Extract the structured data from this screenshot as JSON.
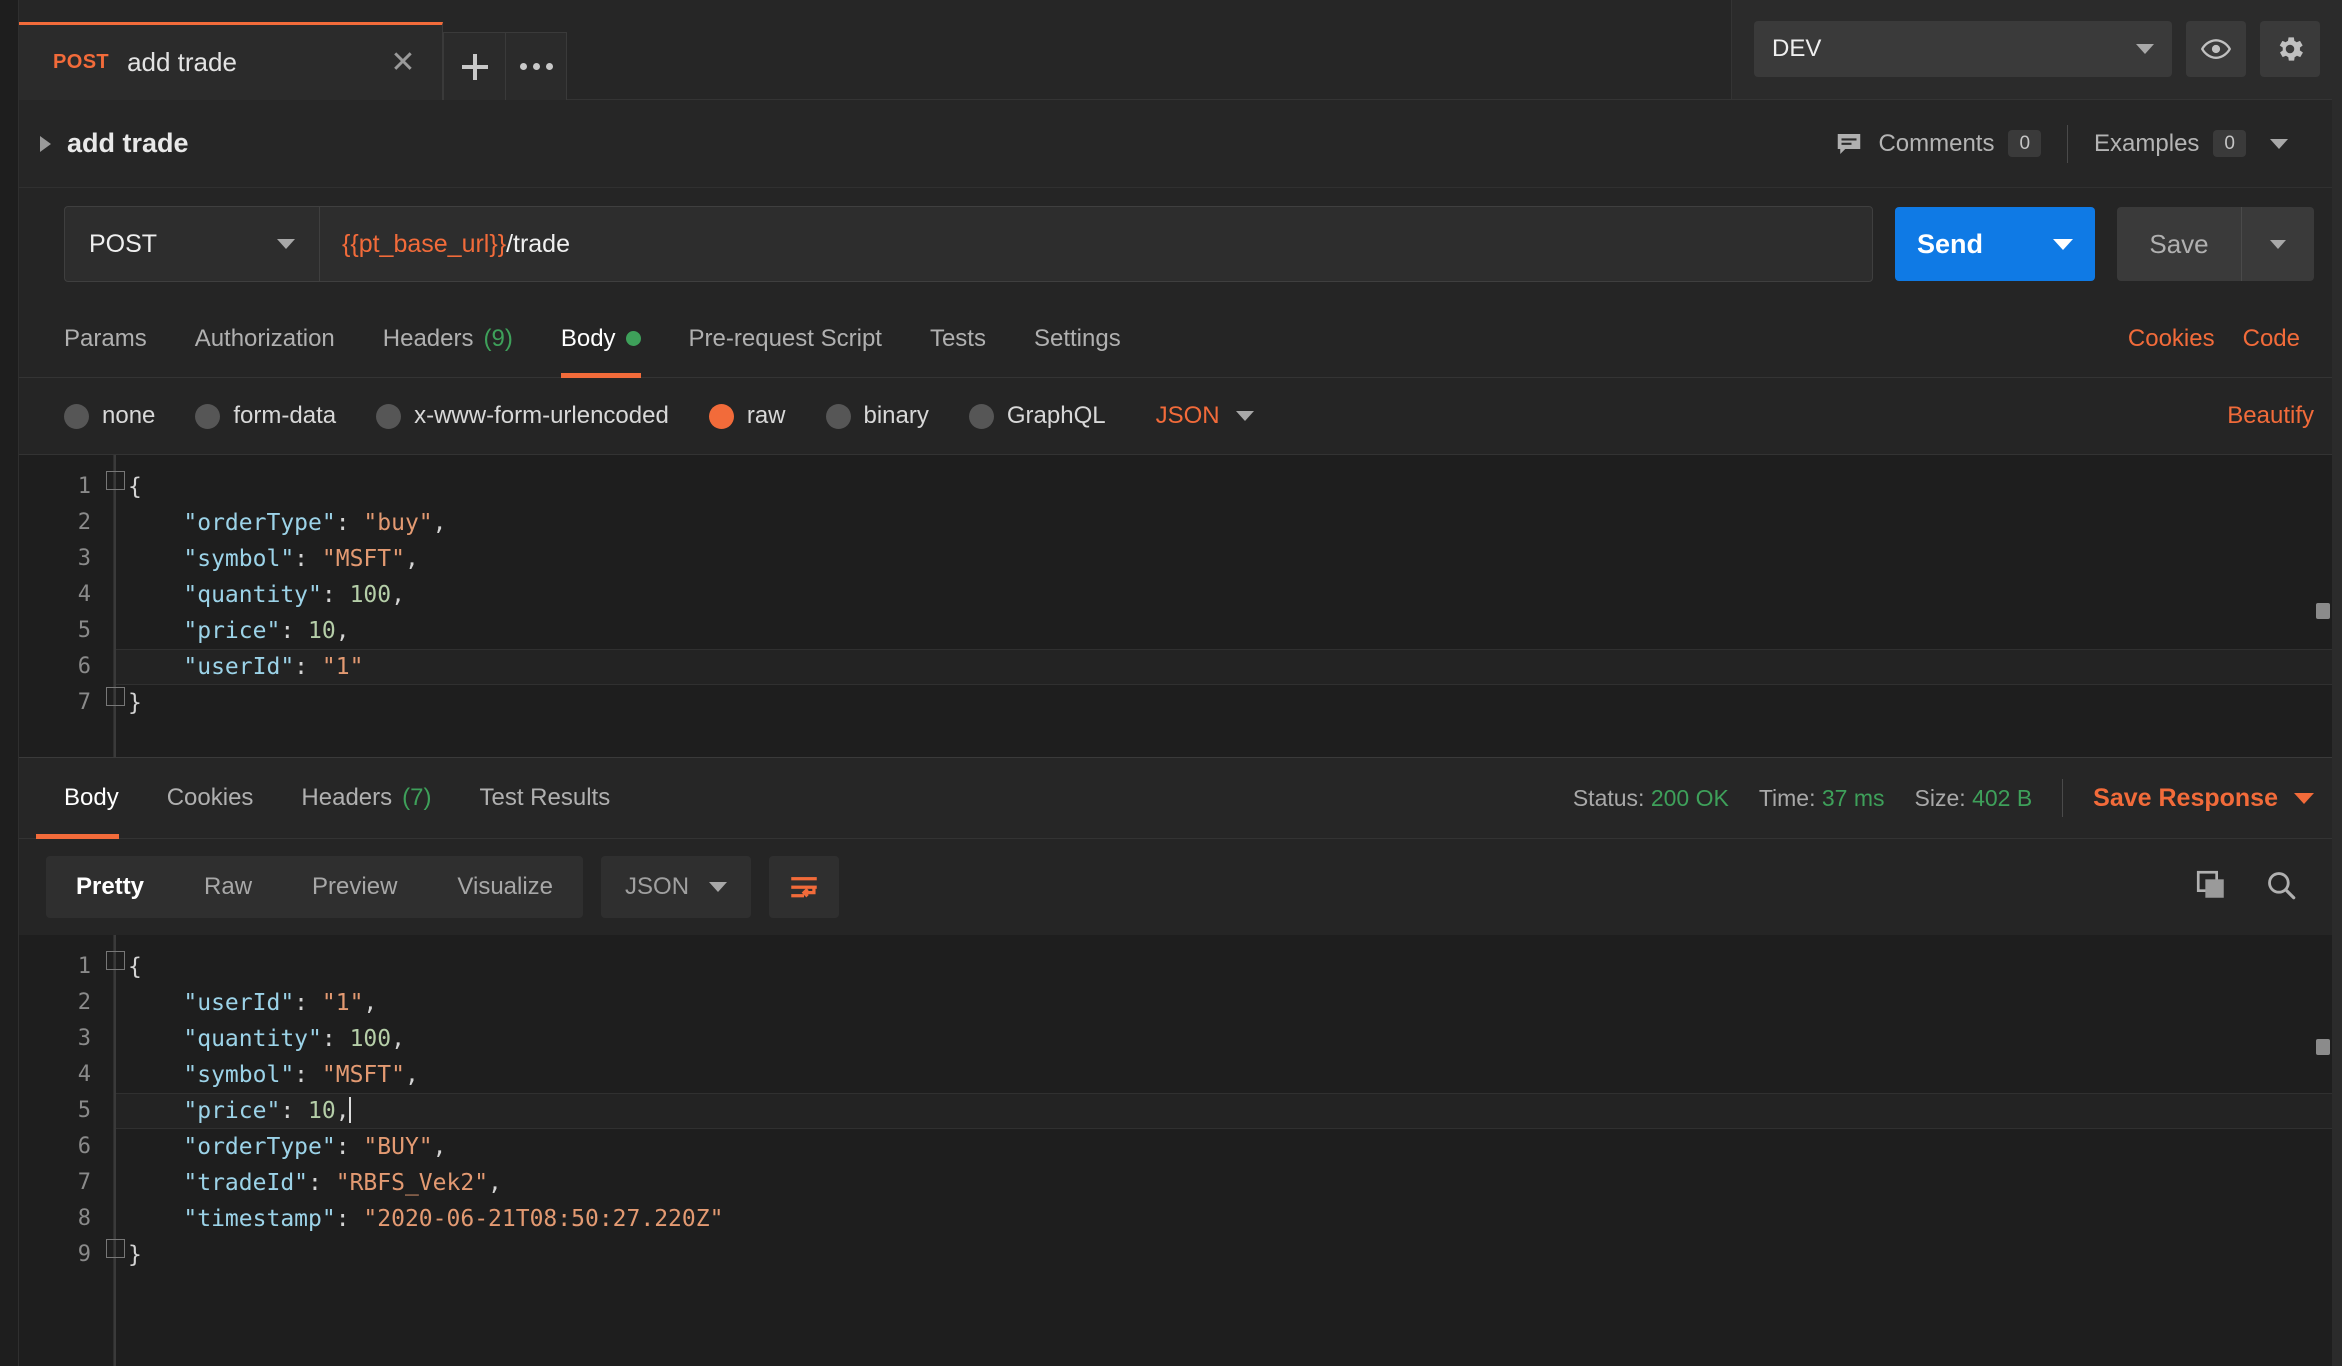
{
  "window": {
    "tab": {
      "method": "POST",
      "title": "add trade",
      "close_icon": "close-icon",
      "new_tab_icon": "plus-icon",
      "more_icon": "ellipsis-icon"
    },
    "environment": {
      "selected": "DEV",
      "eye_icon": "eye-icon",
      "gear_icon": "gear-icon"
    }
  },
  "breadcrumb": {
    "expander_icon": "chevron-right-icon",
    "title": "add trade",
    "comments_icon": "comment-icon",
    "comments_label": "Comments",
    "comments_count": "0",
    "examples_label": "Examples",
    "examples_count": "0"
  },
  "request": {
    "method": "POST",
    "url_variable": "{{pt_base_url}}",
    "url_path": "/trade",
    "send_label": "Send",
    "save_label": "Save",
    "tabs": [
      {
        "label": "Params",
        "count": "",
        "active": false
      },
      {
        "label": "Authorization",
        "count": "",
        "active": false
      },
      {
        "label": "Headers",
        "count": "(9)",
        "active": false
      },
      {
        "label": "Body",
        "count": "",
        "active": true
      },
      {
        "label": "Pre-request Script",
        "count": "",
        "active": false
      },
      {
        "label": "Tests",
        "count": "",
        "active": false
      },
      {
        "label": "Settings",
        "count": "",
        "active": false
      }
    ],
    "cookies_link": "Cookies",
    "code_link": "Code",
    "body_types": [
      {
        "label": "none",
        "selected": false
      },
      {
        "label": "form-data",
        "selected": false
      },
      {
        "label": "x-www-form-urlencoded",
        "selected": false
      },
      {
        "label": "raw",
        "selected": true
      },
      {
        "label": "binary",
        "selected": false
      },
      {
        "label": "GraphQL",
        "selected": false
      }
    ],
    "raw_format": "JSON",
    "beautify_label": "Beautify",
    "body_lines": [
      {
        "n": "1",
        "tokens": [
          {
            "t": "p",
            "v": "{"
          }
        ]
      },
      {
        "n": "2",
        "tokens": [
          {
            "t": "p",
            "v": "    "
          },
          {
            "t": "k",
            "v": "\"orderType\""
          },
          {
            "t": "p",
            "v": ": "
          },
          {
            "t": "s",
            "v": "\"buy\""
          },
          {
            "t": "p",
            "v": ","
          }
        ]
      },
      {
        "n": "3",
        "tokens": [
          {
            "t": "p",
            "v": "    "
          },
          {
            "t": "k",
            "v": "\"symbol\""
          },
          {
            "t": "p",
            "v": ": "
          },
          {
            "t": "s",
            "v": "\"MSFT\""
          },
          {
            "t": "p",
            "v": ","
          }
        ]
      },
      {
        "n": "4",
        "tokens": [
          {
            "t": "p",
            "v": "    "
          },
          {
            "t": "k",
            "v": "\"quantity\""
          },
          {
            "t": "p",
            "v": ": "
          },
          {
            "t": "n",
            "v": "100"
          },
          {
            "t": "p",
            "v": ","
          }
        ]
      },
      {
        "n": "5",
        "tokens": [
          {
            "t": "p",
            "v": "    "
          },
          {
            "t": "k",
            "v": "\"price\""
          },
          {
            "t": "p",
            "v": ": "
          },
          {
            "t": "n",
            "v": "10"
          },
          {
            "t": "p",
            "v": ","
          }
        ]
      },
      {
        "n": "6",
        "hl": true,
        "tokens": [
          {
            "t": "p",
            "v": "    "
          },
          {
            "t": "k",
            "v": "\"userId\""
          },
          {
            "t": "p",
            "v": ": "
          },
          {
            "t": "s",
            "v": "\"1\""
          }
        ]
      },
      {
        "n": "7",
        "tokens": [
          {
            "t": "p",
            "v": "}"
          }
        ]
      }
    ]
  },
  "response": {
    "tabs": [
      {
        "label": "Body",
        "count": "",
        "active": true
      },
      {
        "label": "Cookies",
        "count": "",
        "active": false
      },
      {
        "label": "Headers",
        "count": "(7)",
        "active": false
      },
      {
        "label": "Test Results",
        "count": "",
        "active": false
      }
    ],
    "status_label": "Status:",
    "status_value": "200 OK",
    "time_label": "Time:",
    "time_value": "37 ms",
    "size_label": "Size:",
    "size_value": "402 B",
    "save_response_label": "Save Response",
    "view_modes": [
      {
        "label": "Pretty",
        "active": true
      },
      {
        "label": "Raw",
        "active": false
      },
      {
        "label": "Preview",
        "active": false
      },
      {
        "label": "Visualize",
        "active": false
      }
    ],
    "format": "JSON",
    "wrap_icon": "word-wrap-icon",
    "copy_icon": "copy-icon",
    "search_icon": "search-icon",
    "body_lines": [
      {
        "n": "1",
        "tokens": [
          {
            "t": "p",
            "v": "{"
          }
        ]
      },
      {
        "n": "2",
        "tokens": [
          {
            "t": "p",
            "v": "    "
          },
          {
            "t": "k",
            "v": "\"userId\""
          },
          {
            "t": "p",
            "v": ": "
          },
          {
            "t": "s",
            "v": "\"1\""
          },
          {
            "t": "p",
            "v": ","
          }
        ]
      },
      {
        "n": "3",
        "tokens": [
          {
            "t": "p",
            "v": "    "
          },
          {
            "t": "k",
            "v": "\"quantity\""
          },
          {
            "t": "p",
            "v": ": "
          },
          {
            "t": "n",
            "v": "100"
          },
          {
            "t": "p",
            "v": ","
          }
        ]
      },
      {
        "n": "4",
        "tokens": [
          {
            "t": "p",
            "v": "    "
          },
          {
            "t": "k",
            "v": "\"symbol\""
          },
          {
            "t": "p",
            "v": ": "
          },
          {
            "t": "s",
            "v": "\"MSFT\""
          },
          {
            "t": "p",
            "v": ","
          }
        ]
      },
      {
        "n": "5",
        "hl": true,
        "cursor": true,
        "tokens": [
          {
            "t": "p",
            "v": "    "
          },
          {
            "t": "k",
            "v": "\"price\""
          },
          {
            "t": "p",
            "v": ": "
          },
          {
            "t": "n",
            "v": "10"
          },
          {
            "t": "p",
            "v": ","
          }
        ]
      },
      {
        "n": "6",
        "tokens": [
          {
            "t": "p",
            "v": "    "
          },
          {
            "t": "k",
            "v": "\"orderType\""
          },
          {
            "t": "p",
            "v": ": "
          },
          {
            "t": "s",
            "v": "\"BUY\""
          },
          {
            "t": "p",
            "v": ","
          }
        ]
      },
      {
        "n": "7",
        "tokens": [
          {
            "t": "p",
            "v": "    "
          },
          {
            "t": "k",
            "v": "\"tradeId\""
          },
          {
            "t": "p",
            "v": ": "
          },
          {
            "t": "s",
            "v": "\"RBFS_Vek2\""
          },
          {
            "t": "p",
            "v": ","
          }
        ]
      },
      {
        "n": "8",
        "tokens": [
          {
            "t": "p",
            "v": "    "
          },
          {
            "t": "k",
            "v": "\"timestamp\""
          },
          {
            "t": "p",
            "v": ": "
          },
          {
            "t": "s",
            "v": "\"2020-06-21T08:50:27.220Z\""
          }
        ]
      },
      {
        "n": "9",
        "tokens": [
          {
            "t": "p",
            "v": "}"
          }
        ]
      }
    ]
  },
  "colors": {
    "accent_orange": "#f26b3a",
    "send_blue": "#0f7ae5",
    "status_green": "#3ea05a",
    "json_key": "#9cd3e8",
    "json_string": "#e39a72",
    "json_number": "#b5cea8"
  }
}
